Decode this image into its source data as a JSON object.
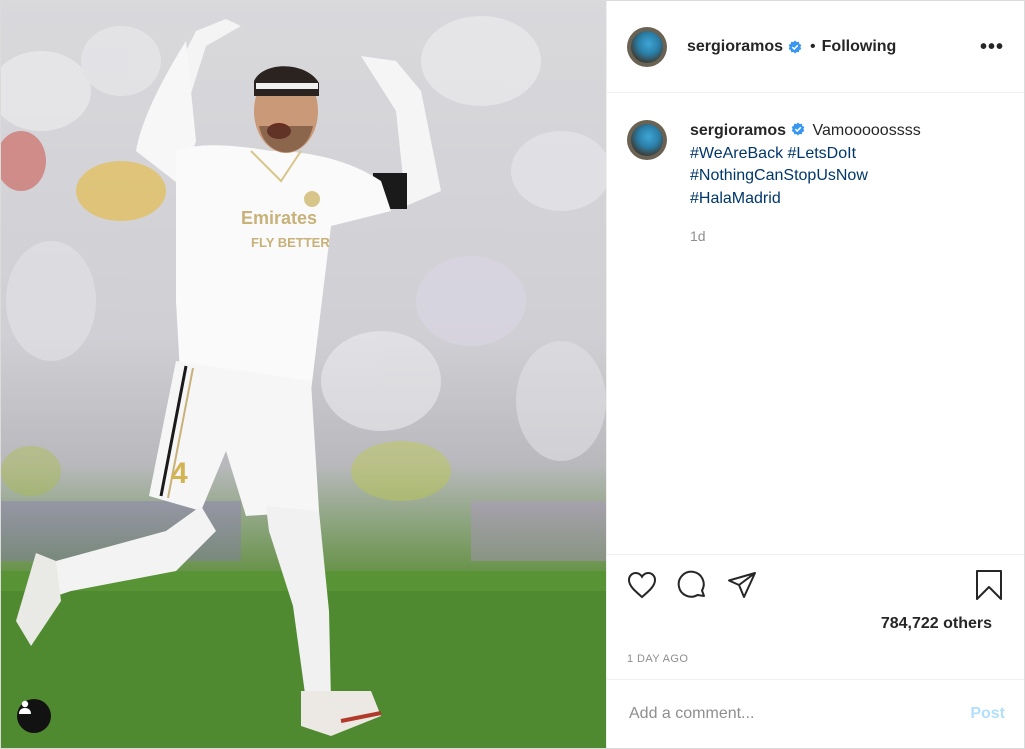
{
  "post": {
    "username": "sergioramos",
    "separator": "•",
    "follow_status": "Following",
    "more_icon": "more-horizontal-icon",
    "more_label": "•••"
  },
  "caption": {
    "username": "sergioramos",
    "text": "Vamooooossss",
    "hashtags": [
      "#WeAreBack",
      "#LetsDoIt",
      "#NothingCanStopUsNow",
      "#HalaMadrid"
    ],
    "age": "1d"
  },
  "actions": {
    "like_icon": "heart-icon",
    "comment_icon": "comment-icon",
    "share_icon": "send-icon",
    "save_icon": "bookmark-icon"
  },
  "likes": {
    "text": "784,722 others"
  },
  "post_time": "1 DAY AGO",
  "comment": {
    "placeholder": "Add a comment...",
    "post_label": "Post"
  },
  "colors": {
    "verified": "#3897f0",
    "hashtag": "#00376b",
    "post_button_disabled": "#b2dffc",
    "muted_text": "#8e8e8e"
  }
}
